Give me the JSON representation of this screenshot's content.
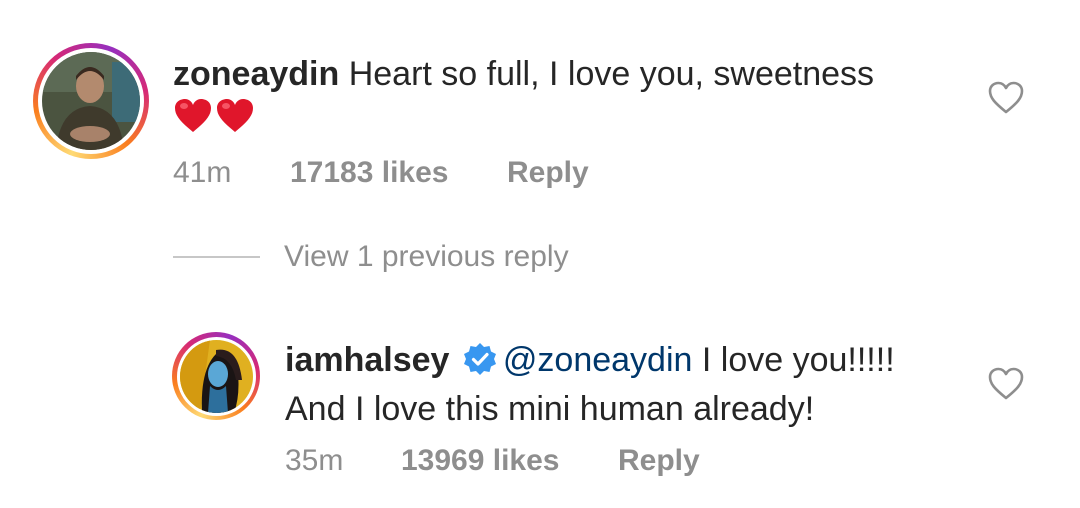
{
  "comments": [
    {
      "username": "zoneaydin",
      "text": "Heart so full, I love you, sweetness",
      "emoji": "❤❤",
      "time": "41m",
      "likes": "17183 likes",
      "reply_label": "Reply",
      "avatar_icon": "user-photo-icon"
    },
    {
      "username": "iamhalsey",
      "verified": true,
      "mention": "@zoneaydin",
      "text_line1": " I love you!!!!!",
      "text_line2": "And I love this mini human already!",
      "time": "35m",
      "likes": "13969 likes",
      "reply_label": "Reply",
      "avatar_icon": "user-photo-icon"
    }
  ],
  "view_replies_label": "View 1 previous reply",
  "colors": {
    "text": "#262626",
    "muted": "#8e8e8e",
    "mention": "#00376b",
    "verified": "#3897f0",
    "heart_emoji": "#e0162b"
  }
}
